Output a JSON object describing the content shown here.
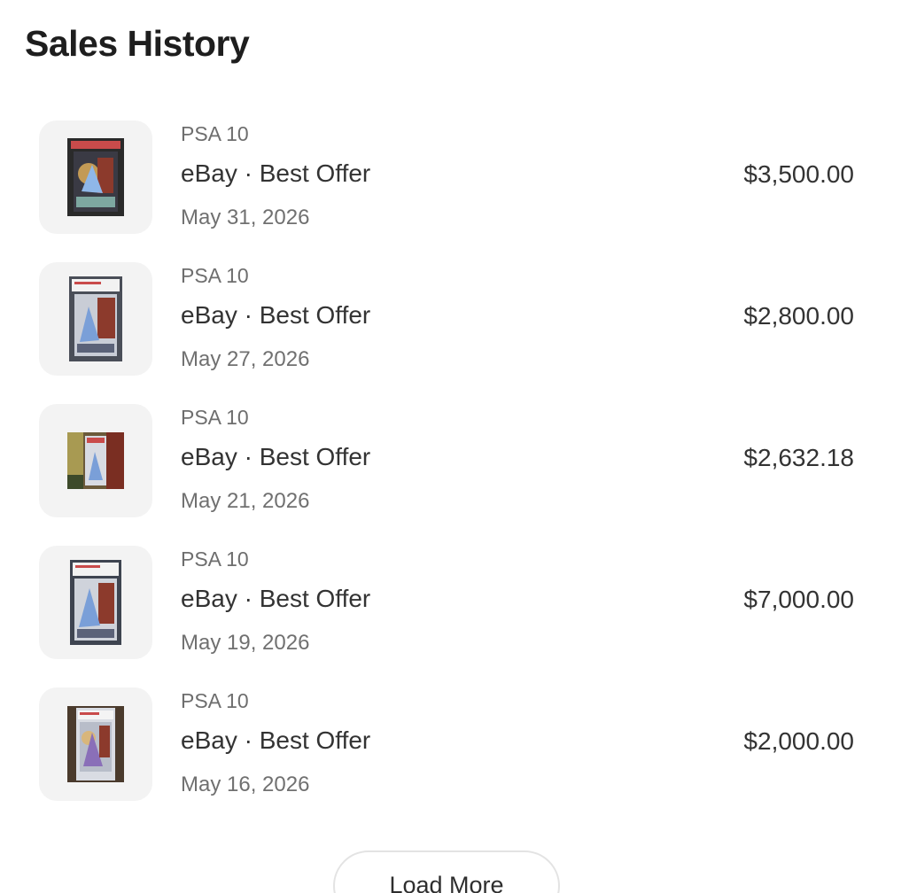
{
  "header": {
    "title": "Sales History"
  },
  "sales": [
    {
      "grade": "PSA 10",
      "source": "eBay · Best Offer",
      "date": "May 31, 2026",
      "price": "$3,500.00",
      "thumbnail": "graded-card-photo"
    },
    {
      "grade": "PSA 10",
      "source": "eBay · Best Offer",
      "date": "May 27, 2026",
      "price": "$2,800.00",
      "thumbnail": "graded-card-photo"
    },
    {
      "grade": "PSA 10",
      "source": "eBay · Best Offer",
      "date": "May 21, 2026",
      "price": "$2,632.18",
      "thumbnail": "graded-card-photo"
    },
    {
      "grade": "PSA 10",
      "source": "eBay · Best Offer",
      "date": "May 19, 2026",
      "price": "$7,000.00",
      "thumbnail": "graded-card-photo"
    },
    {
      "grade": "PSA 10",
      "source": "eBay · Best Offer",
      "date": "May 16, 2026",
      "price": "$2,000.00",
      "thumbnail": "graded-card-photo"
    }
  ],
  "footer": {
    "load_more_label": "Load More"
  },
  "colors": {
    "thumb_bg": "#f3f3f3",
    "text_primary": "#333333",
    "text_secondary": "#707070",
    "button_border": "#e3e3e3"
  }
}
